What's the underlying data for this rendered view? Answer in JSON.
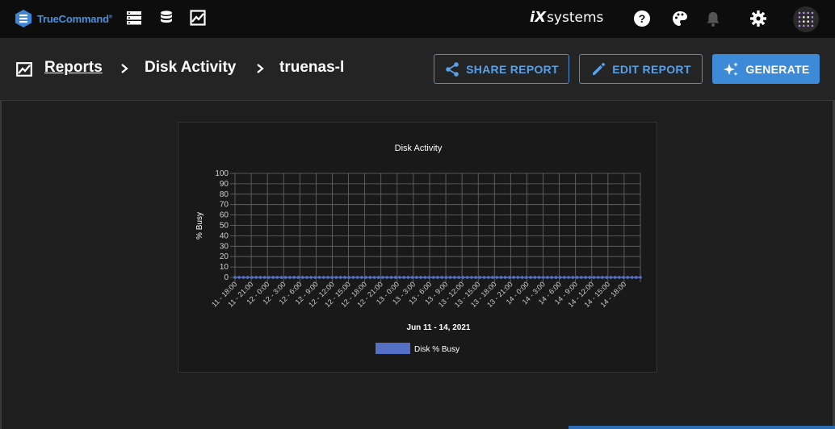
{
  "topbar": {
    "logo_text": "TrueCommand",
    "logo_mark": "®",
    "brand_text": "systems",
    "brand_mark": "iX",
    "nav_icons": [
      "server-icon",
      "database-icon",
      "reports-icon"
    ],
    "right_icons": [
      "help-icon",
      "palette-icon",
      "bell-icon",
      "gear-icon",
      "user-avatar"
    ]
  },
  "breadcrumb": {
    "items": [
      "Reports",
      "Disk Activity",
      "truenas-l"
    ]
  },
  "actions": {
    "share_label": "SHARE REPORT",
    "edit_label": "EDIT REPORT",
    "generate_label": "GENERATE"
  },
  "colors": {
    "accent": "#3d8ad9",
    "series": "#5470c6",
    "background": "#1e1e1e"
  },
  "chart_data": {
    "type": "line",
    "title": "Disk Activity",
    "xlabel": "Jun 11 - 14, 2021",
    "ylabel": "% Busy",
    "ylim": [
      0,
      100
    ],
    "yticks": [
      "0",
      "10",
      "20",
      "30",
      "40",
      "50",
      "60",
      "70",
      "80",
      "90",
      "100"
    ],
    "xticks": [
      "11 - 18:00",
      "11 - 21:00",
      "12 - 0:00",
      "12 - 3:00",
      "12 - 6:00",
      "12 - 9:00",
      "12 - 12:00",
      "12 - 15:00",
      "12 - 18:00",
      "12 - 21:00",
      "13 - 0:00",
      "13 - 3:00",
      "13 - 6:00",
      "13 - 9:00",
      "13 - 12:00",
      "13 - 15:00",
      "13 - 18:00",
      "13 - 21:00",
      "14 - 0:00",
      "14 - 3:00",
      "14 - 6:00",
      "14 - 9:00",
      "14 - 12:00",
      "14 - 15:00",
      "14 - 18:00"
    ],
    "grid": true,
    "legend_position": "bottom",
    "series": [
      {
        "name": "Disk % Busy",
        "values": [
          0,
          0,
          0,
          0,
          0,
          0,
          0,
          0,
          0,
          0,
          0,
          0,
          0,
          0,
          0,
          0,
          0,
          0,
          0,
          0,
          0,
          0,
          0,
          0,
          0,
          0,
          0,
          0,
          0,
          0,
          0,
          0,
          0,
          0,
          0,
          0,
          0,
          0,
          0,
          0,
          0,
          0,
          0,
          0,
          0,
          0,
          0,
          0,
          0,
          0,
          0,
          0,
          0,
          0,
          0,
          0,
          0,
          0,
          0,
          0,
          0,
          0,
          0,
          0,
          0,
          0,
          0,
          0,
          0,
          0,
          0,
          0,
          0,
          0,
          0,
          0,
          0,
          0,
          0,
          0,
          0,
          0,
          0,
          0,
          0,
          0,
          0,
          0,
          0,
          0,
          0,
          0,
          0,
          0,
          0,
          0,
          0
        ]
      }
    ]
  }
}
